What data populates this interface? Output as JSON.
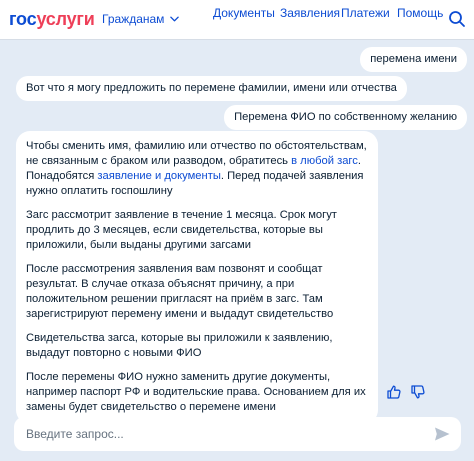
{
  "header": {
    "logo_part1": "гос",
    "logo_part2": "услуги",
    "audience_label": "Гражданам",
    "nav": [
      "Документы",
      "Заявления",
      "Платежи",
      "Помощь"
    ]
  },
  "chat": {
    "user_message_1": "перемена имени",
    "bot_message_1": "Вот что я могу предложить по перемене фамилии, имени или отчества",
    "user_message_2": "Перемена ФИО по собственному желанию",
    "bot_message_2": {
      "p1_before": "Чтобы сменить имя, фамилию или отчество по обстоятельствам, не связанным с браком или разводом, обратитесь ",
      "p1_link1": "в любой загс",
      "p1_middle": ". Понадобятся ",
      "p1_link2": "заявление и документы",
      "p1_after": ". Перед подачей заявления нужно оплатить госпошлину",
      "p2": "Загс рассмотрит заявление в течение 1 месяца. Срок могут продлить до 3 месяцев, если свидетельства, которые вы приложили, были выданы другими загсами",
      "p3": "После рассмотрения заявления вам позвонят и сообщат результат. В случае отказа объяснят причину, а при положительном решении пригласят на приём в загс. Там зарегистрируют перемену имени и выдадут свидетельство",
      "p4": "Свидетельства загса, которые вы приложили к заявлению, выдадут повторно с новыми ФИО",
      "p5": "После перемены ФИО нужно заменить другие документы, например паспорт РФ и водительские права. Основанием для их замены будет свидетельство о перемене имени"
    }
  },
  "input": {
    "placeholder": "Введите запрос..."
  },
  "icons": {
    "search": "search-icon",
    "chevron": "chevron-down-icon",
    "like": "thumbs-up-icon",
    "dislike": "thumbs-down-icon",
    "send": "send-icon"
  },
  "colors": {
    "brand_blue": "#0d4cd3",
    "brand_red": "#ee3f58",
    "background": "#e3ebf5",
    "send_icon": "#b6c1cf"
  }
}
